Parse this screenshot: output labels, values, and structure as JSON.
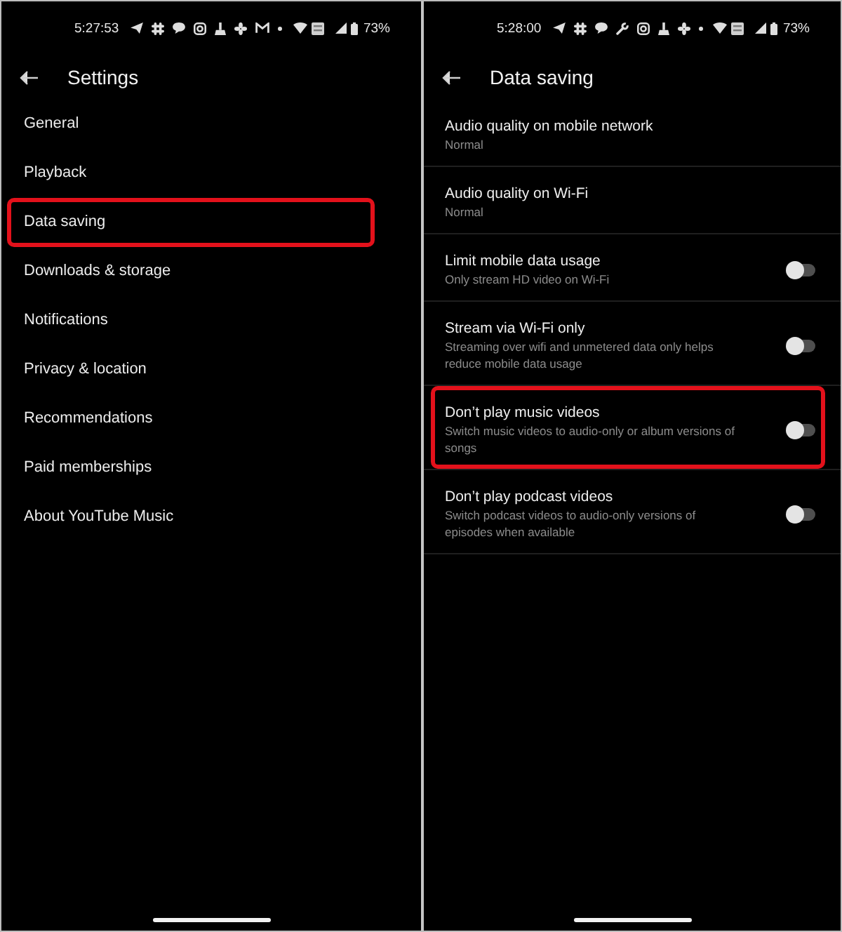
{
  "screens": [
    {
      "status_bar": {
        "time": "5:27:53",
        "battery": "73%"
      },
      "header": {
        "title": "Settings"
      },
      "menu_items": [
        {
          "label": "General",
          "highlighted": false
        },
        {
          "label": "Playback",
          "highlighted": false
        },
        {
          "label": "Data saving",
          "highlighted": true
        },
        {
          "label": "Downloads & storage",
          "highlighted": false
        },
        {
          "label": "Notifications",
          "highlighted": false
        },
        {
          "label": "Privacy & location",
          "highlighted": false
        },
        {
          "label": "Recommendations",
          "highlighted": false
        },
        {
          "label": "Paid memberships",
          "highlighted": false
        },
        {
          "label": "About YouTube Music",
          "highlighted": false
        }
      ]
    },
    {
      "status_bar": {
        "time": "5:28:00",
        "battery": "73%"
      },
      "header": {
        "title": "Data saving"
      },
      "settings": [
        {
          "kind": "choice",
          "title": "Audio quality on mobile network",
          "subtitle": "Normal",
          "highlighted": false
        },
        {
          "kind": "choice",
          "title": "Audio quality on Wi-Fi",
          "subtitle": "Normal",
          "highlighted": false
        },
        {
          "kind": "toggle",
          "title": "Limit mobile data usage",
          "subtitle": "Only stream HD video on Wi-Fi",
          "on": false,
          "highlighted": false
        },
        {
          "kind": "toggle",
          "title": "Stream via Wi-Fi only",
          "subtitle": "Streaming over wifi and unmetered data only helps reduce mobile data usage",
          "on": false,
          "highlighted": false
        },
        {
          "kind": "toggle",
          "title": "Don’t play music videos",
          "subtitle": "Switch music videos to audio-only or album versions of songs",
          "on": false,
          "highlighted": true
        },
        {
          "kind": "toggle",
          "title": "Don’t play podcast videos",
          "subtitle": "Switch podcast videos to audio-only versions of episodes when available",
          "on": false,
          "highlighted": false
        }
      ]
    }
  ]
}
